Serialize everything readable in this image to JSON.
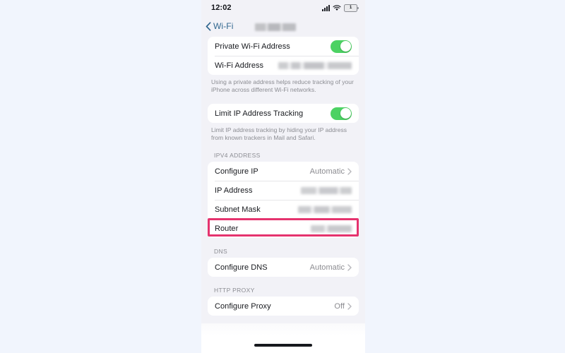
{
  "status_bar": {
    "time": "12:02",
    "cellular_icon": "signal-bars-icon",
    "wifi_icon": "wifi-icon",
    "battery_icon": "battery-icon",
    "battery_level": "1"
  },
  "nav": {
    "back_label": "Wi-Fi",
    "back_icon": "chevron-left-icon",
    "title_redacted": true
  },
  "sections": {
    "privacy_group": {
      "rows": [
        {
          "label": "Private Wi-Fi Address",
          "control": "toggle",
          "toggle_on": true
        },
        {
          "label": "Wi-Fi Address",
          "control": "redacted-value"
        }
      ],
      "footer": "Using a private address helps reduce tracking of your iPhone across different Wi-Fi networks."
    },
    "tracking_group": {
      "rows": [
        {
          "label": "Limit IP Address Tracking",
          "control": "toggle",
          "toggle_on": true
        }
      ],
      "footer": "Limit IP address tracking by hiding your IP address from known trackers in Mail and Safari."
    },
    "ipv4": {
      "header": "IPV4 ADDRESS",
      "rows": [
        {
          "label": "Configure IP",
          "value": "Automatic",
          "chevron": true
        },
        {
          "label": "IP Address",
          "control": "redacted-value"
        },
        {
          "label": "Subnet Mask",
          "control": "redacted-value"
        },
        {
          "label": "Router",
          "control": "redacted-value",
          "highlighted": true
        }
      ]
    },
    "dns": {
      "header": "DNS",
      "rows": [
        {
          "label": "Configure DNS",
          "value": "Automatic",
          "chevron": true
        }
      ]
    },
    "http_proxy": {
      "header": "HTTP PROXY",
      "rows": [
        {
          "label": "Configure Proxy",
          "value": "Off",
          "chevron": true
        }
      ]
    }
  },
  "home_indicator": "home-indicator-bar",
  "colors": {
    "page_background": "#f1f5fd",
    "screen_background": "#f2f2f7",
    "card": "#ffffff",
    "toggle_on": "#4cd263",
    "accent_link": "#31678f",
    "secondary_text": "#8b8c92",
    "annotation_highlight": "#e5336e"
  }
}
